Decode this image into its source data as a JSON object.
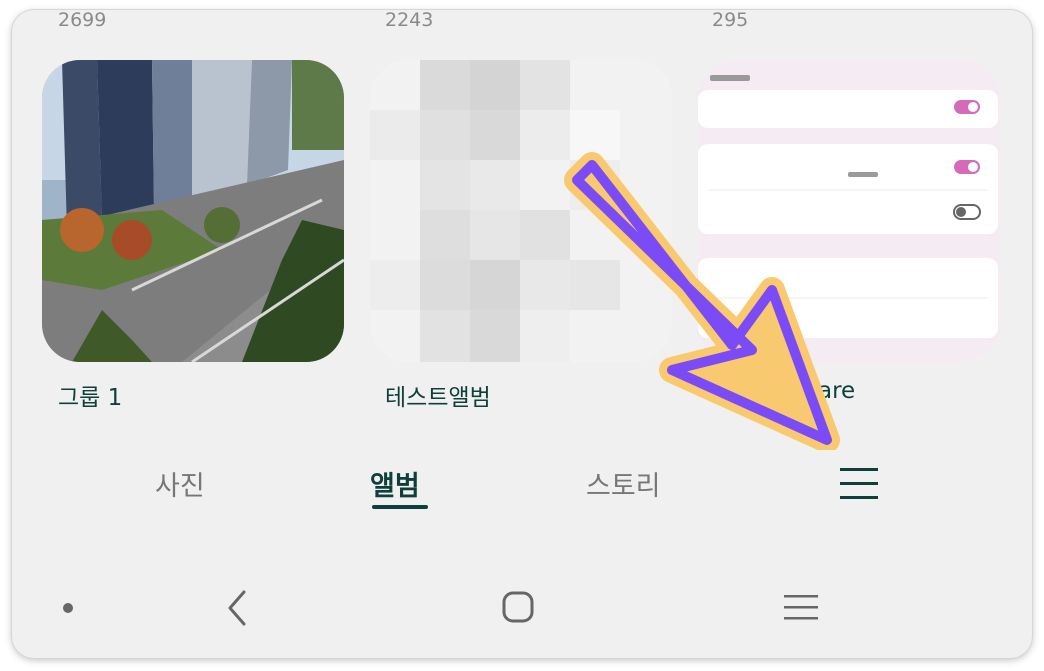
{
  "albums": [
    {
      "count": "2699",
      "name": "그룹 1",
      "thumb": "photo-buildings"
    },
    {
      "count": "2243",
      "name": "테스트앨범",
      "thumb": "blurred-pixelated"
    },
    {
      "count": "295",
      "name": "Share",
      "name_visible": "are",
      "thumb": "settings-screenshot"
    }
  ],
  "nav_tabs": [
    {
      "label": "사진",
      "active": false
    },
    {
      "label": "앨범",
      "active": true
    },
    {
      "label": "스토리",
      "active": false
    },
    {
      "label": "menu",
      "icon": "hamburger-menu-icon"
    }
  ],
  "system_nav": [
    "dot-indicator-icon",
    "back-icon",
    "home-icon",
    "recents-icon"
  ],
  "annotation": {
    "type": "arrow",
    "color": "#7b4cf5",
    "outline": "#f9c970"
  },
  "colors": {
    "accent": "#0f3f3a",
    "background": "#f0f0f0",
    "toggle_on": "#d46ab8"
  }
}
